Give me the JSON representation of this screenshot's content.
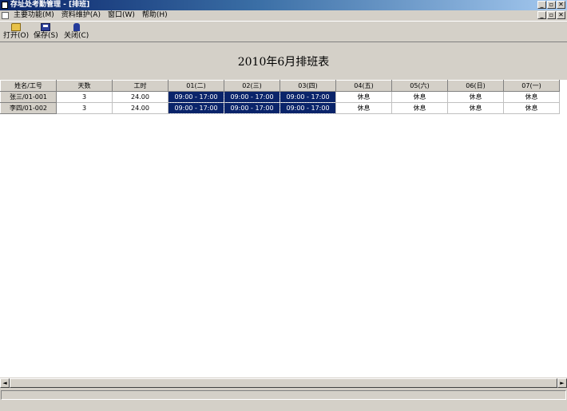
{
  "window": {
    "title": "存址处考勤管理 - [排班]",
    "controls": [
      "_",
      "▫",
      "✕"
    ]
  },
  "menu": {
    "items": [
      "主要功能(M)",
      "资料维护(A)",
      "窗口(W)",
      "帮助(H)"
    ],
    "mdi_controls": [
      "_",
      "▫",
      "✕"
    ]
  },
  "toolbar": {
    "open_label": "打开(O)",
    "save_label": "保存(S)",
    "close_label": "关闭(C)"
  },
  "page": {
    "title": "2010年6月排班表"
  },
  "grid": {
    "headers": [
      "姓名/工号",
      "天数",
      "工时",
      "01(二)",
      "02(三)",
      "03(四)",
      "04(五)",
      "05(六)",
      "06(日)",
      "07(一)"
    ],
    "rows": [
      {
        "cells": [
          "张三/01-001",
          "3",
          "24.00",
          "09:00 - 17:00",
          "09:00 - 17:00",
          "09:00 - 17:00",
          "休息",
          "休息",
          "休息",
          "休息"
        ]
      },
      {
        "cells": [
          "李四/01-002",
          "3",
          "24.00",
          "09:00 - 17:00",
          "09:00 - 17:00",
          "09:00 - 17:00",
          "休息",
          "休息",
          "休息",
          "休息"
        ]
      }
    ]
  },
  "scrollbar": {
    "left_arrow": "◄",
    "right_arrow": "►"
  },
  "colors": {
    "selected_shift_bg": "#0a246a",
    "window_bg": "#d4d0c8"
  }
}
